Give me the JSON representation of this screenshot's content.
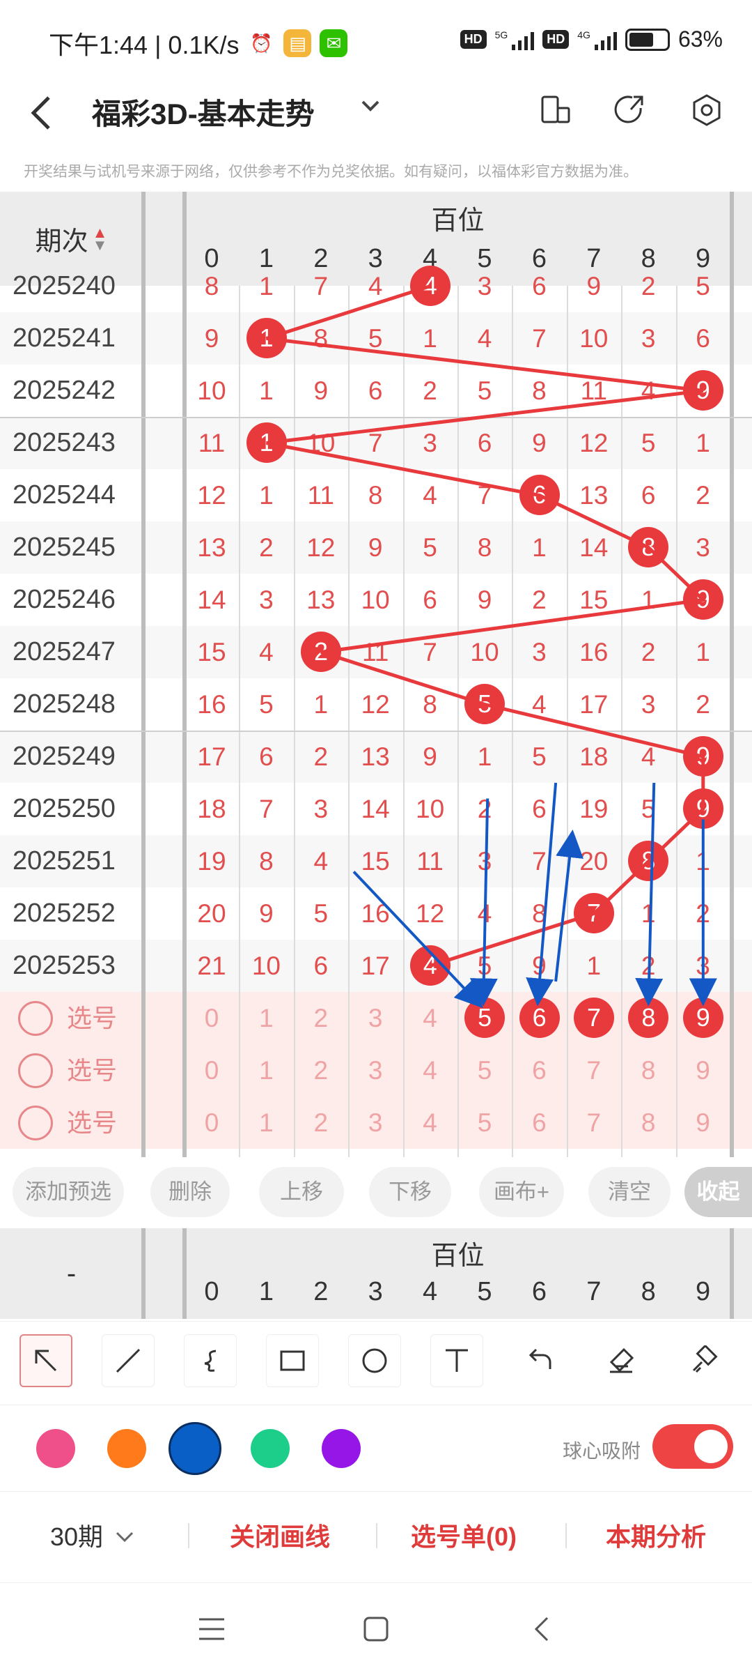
{
  "status": {
    "time": "下午1:44 | 0.1K/s",
    "network_hd": "HD",
    "net5g": "5G",
    "net4g": "4G",
    "battery": "63%"
  },
  "header": {
    "title": "福彩3D-基本走势"
  },
  "disclaimer": "开奖结果与试机号来源于网络，仅供参考不作为兑奖依据。如有疑问，以福体彩官方数据为准。",
  "table": {
    "period_header": "期次",
    "group_label": "百位",
    "digits": [
      "0",
      "1",
      "2",
      "3",
      "4",
      "5",
      "6",
      "7",
      "8",
      "9"
    ],
    "rows": [
      {
        "period": "2025240",
        "cells": [
          "8",
          "1",
          "7",
          "4",
          "4",
          "3",
          "6",
          "9",
          "2",
          "5"
        ],
        "hit": 4
      },
      {
        "period": "2025241",
        "cells": [
          "9",
          "1",
          "8",
          "5",
          "1",
          "4",
          "7",
          "10",
          "3",
          "6"
        ],
        "hit": 1
      },
      {
        "period": "2025242",
        "cells": [
          "10",
          "1",
          "9",
          "6",
          "2",
          "5",
          "8",
          "11",
          "4",
          "9"
        ],
        "hit": 9
      },
      {
        "period": "2025243",
        "cells": [
          "11",
          "1",
          "10",
          "7",
          "3",
          "6",
          "9",
          "12",
          "5",
          "1"
        ],
        "hit": 1
      },
      {
        "period": "2025244",
        "cells": [
          "12",
          "1",
          "11",
          "8",
          "4",
          "7",
          "6",
          "13",
          "6",
          "2"
        ],
        "hit": 6
      },
      {
        "period": "2025245",
        "cells": [
          "13",
          "2",
          "12",
          "9",
          "5",
          "8",
          "1",
          "14",
          "8",
          "3"
        ],
        "hit": 8
      },
      {
        "period": "2025246",
        "cells": [
          "14",
          "3",
          "13",
          "10",
          "6",
          "9",
          "2",
          "15",
          "1",
          "9"
        ],
        "hit": 9
      },
      {
        "period": "2025247",
        "cells": [
          "15",
          "4",
          "2",
          "11",
          "7",
          "10",
          "3",
          "16",
          "2",
          "1"
        ],
        "hit": 2
      },
      {
        "period": "2025248",
        "cells": [
          "16",
          "5",
          "1",
          "12",
          "8",
          "5",
          "4",
          "17",
          "3",
          "2"
        ],
        "hit": 5
      },
      {
        "period": "2025249",
        "cells": [
          "17",
          "6",
          "2",
          "13",
          "9",
          "1",
          "5",
          "18",
          "4",
          "9"
        ],
        "hit": 9
      },
      {
        "period": "2025250",
        "cells": [
          "18",
          "7",
          "3",
          "14",
          "10",
          "2",
          "6",
          "19",
          "5",
          "9"
        ],
        "hit": 9
      },
      {
        "period": "2025251",
        "cells": [
          "19",
          "8",
          "4",
          "15",
          "11",
          "3",
          "7",
          "20",
          "8",
          "1"
        ],
        "hit": 8
      },
      {
        "period": "2025252",
        "cells": [
          "20",
          "9",
          "5",
          "16",
          "12",
          "4",
          "8",
          "7",
          "1",
          "2"
        ],
        "hit": 7
      },
      {
        "period": "2025253",
        "cells": [
          "21",
          "10",
          "6",
          "17",
          "4",
          "5",
          "9",
          "1",
          "2",
          "3"
        ],
        "hit": 4
      }
    ],
    "pick_label": "选号",
    "pick_selected": [
      5,
      6,
      7,
      8,
      9
    ]
  },
  "actions": {
    "add": "添加预选",
    "delete": "删除",
    "up": "上移",
    "down": "下移",
    "canvas": "画布+",
    "clear": "清空",
    "collapse": "收起"
  },
  "head2": {
    "dash": "-"
  },
  "drawing": {
    "tools": [
      "pointer-icon",
      "line-icon",
      "freehand-icon",
      "rectangle-icon",
      "circle-icon",
      "text-icon",
      "undo-icon",
      "eraser-icon",
      "clear-canvas-icon"
    ],
    "colors": [
      "#f0508a",
      "#ff7a1a",
      "#0a5fc7",
      "#1dce8a",
      "#9616e8"
    ],
    "selected_color": "#0a5fc7",
    "snap_label": "球心吸附",
    "snap_enabled": true
  },
  "bottom": {
    "periods": "30期",
    "close_lines": "关闭画线",
    "pick_list": "选号单(0)",
    "analysis": "本期分析"
  }
}
